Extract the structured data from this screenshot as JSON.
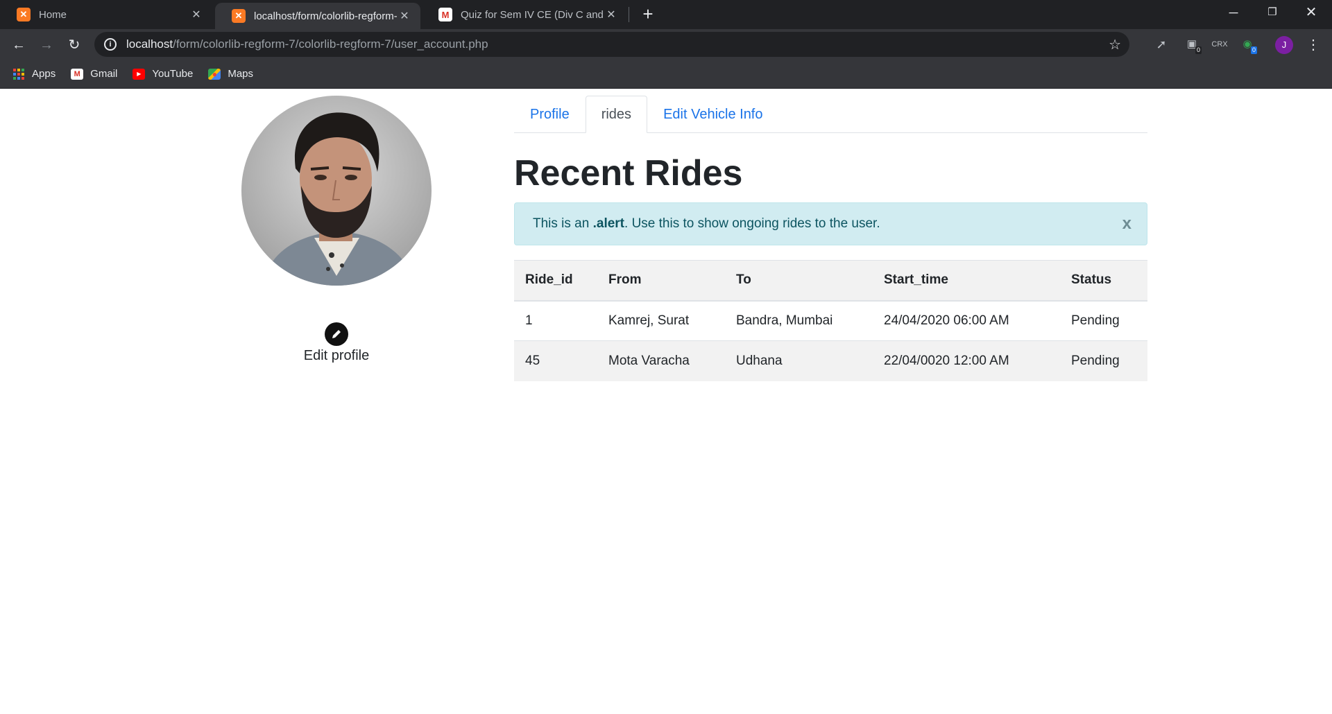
{
  "browser": {
    "tabs": [
      {
        "title": "Home",
        "active": false
      },
      {
        "title": "localhost/form/colorlib-regform-",
        "active": true
      },
      {
        "title": "Quiz for Sem IV CE (Div C and D)",
        "active": false
      }
    ],
    "url_host": "localhost",
    "url_path": "/form/colorlib-regform-7/colorlib-regform-7/user_account.php",
    "bookmarks": [
      {
        "label": "Apps",
        "icon": "apps-grid-icon"
      },
      {
        "label": "Gmail",
        "icon": "gmail-icon"
      },
      {
        "label": "YouTube",
        "icon": "youtube-icon"
      },
      {
        "label": "Maps",
        "icon": "maps-icon"
      }
    ],
    "extensions": {
      "badge_1": "0",
      "crx_label": "CRX",
      "badge_2": "0"
    },
    "profile_initial": "J"
  },
  "profile": {
    "edit_label": "Edit profile"
  },
  "nav": {
    "tabs": [
      "Profile",
      "rides",
      "Edit Vehicle Info"
    ],
    "active": "rides"
  },
  "main": {
    "heading": "Recent Rides",
    "alert": {
      "prefix": "This is an ",
      "bold": ".alert",
      "suffix": ". Use this to show ongoing rides to the user.",
      "close": "x"
    },
    "table": {
      "columns": [
        "Ride_id",
        "From",
        "To",
        "Start_time",
        "Status"
      ],
      "rows": [
        [
          "1",
          "Kamrej, Surat",
          "Bandra, Mumbai",
          "24/04/2020 06:00 AM",
          "Pending"
        ],
        [
          "45",
          "Mota Varacha",
          "Udhana",
          "22/04/0020 12:00 AM",
          "Pending"
        ]
      ]
    }
  },
  "colors": {
    "link": "#1a73e8",
    "alert_bg": "#d1ecf1",
    "alert_text": "#0c5460",
    "chrome_dark": "#202124",
    "chrome_toolbar": "#35363a"
  }
}
